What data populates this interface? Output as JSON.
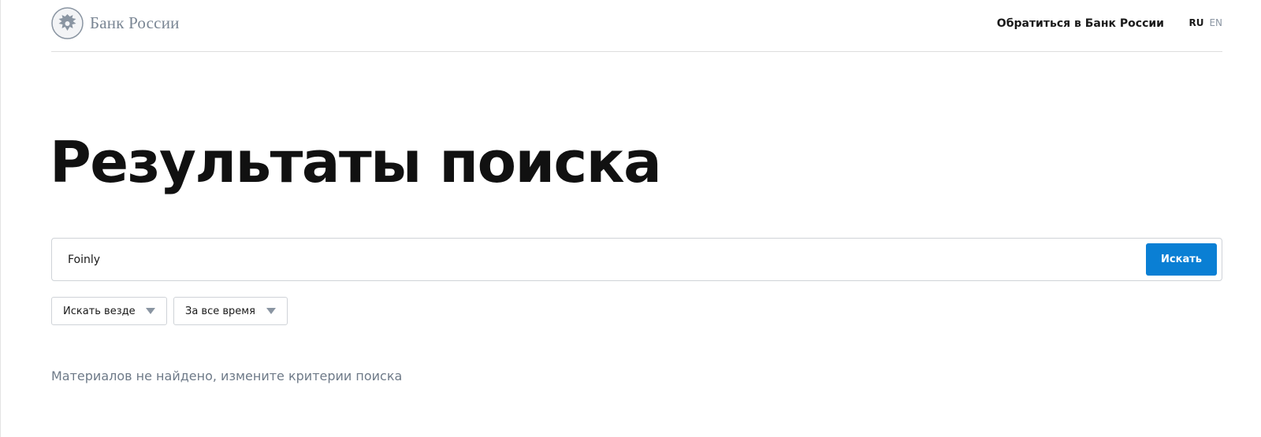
{
  "header": {
    "logo_text": "Банк России",
    "logo_icon": "double-headed-eagle-emblem",
    "contact_link": "Обратиться в Банк России",
    "languages": {
      "active": "RU",
      "inactive": "EN"
    }
  },
  "main": {
    "title": "Результаты поиска",
    "search": {
      "value": "Foinly",
      "button_label": "Искать"
    },
    "filters": [
      {
        "label": "Искать везде",
        "icon": "caret-down-icon"
      },
      {
        "label": "За все время",
        "icon": "caret-down-icon"
      }
    ],
    "empty_message": "Материалов не найдено, измените критерии поиска"
  },
  "colors": {
    "accent": "#0a7fd4",
    "muted_text": "#6e7a88",
    "logo_gray": "#7a8694",
    "border": "#cfd3d8"
  }
}
